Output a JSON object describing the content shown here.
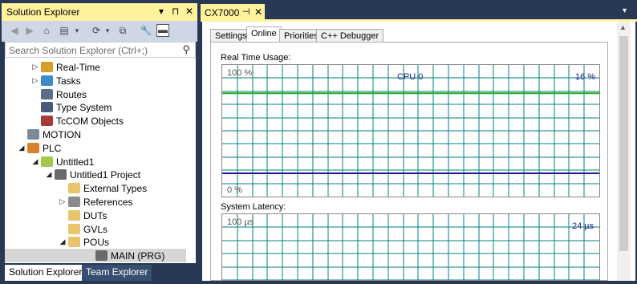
{
  "solution_explorer": {
    "title": "Solution Explorer",
    "title_controls": {
      "dropdown": "▾",
      "pin": "⊓",
      "close": "✕"
    },
    "search_placeholder": "Search Solution Explorer (Ctrl+;)",
    "search_icon": "⚲",
    "tree": [
      {
        "label": "Real-Time",
        "indent": 1,
        "arrow": "▷",
        "icon": "realtime-icon",
        "color": "#D89E2A"
      },
      {
        "label": "Tasks",
        "indent": 1,
        "arrow": "▷",
        "icon": "tasks-icon",
        "color": "#3E8BC9"
      },
      {
        "label": "Routes",
        "indent": 1,
        "arrow": "",
        "icon": "routes-icon",
        "color": "#5A6E8C"
      },
      {
        "label": "Type System",
        "indent": 1,
        "arrow": "",
        "icon": "type-system-icon",
        "color": "#4A5A7A"
      },
      {
        "label": "TcCOM Objects",
        "indent": 1,
        "arrow": "",
        "icon": "tccom-icon",
        "color": "#A93A3A"
      },
      {
        "label": "MOTION",
        "indent": 0,
        "arrow": "",
        "icon": "motion-icon",
        "color": "#7A8A9A"
      },
      {
        "label": "PLC",
        "indent": 0,
        "arrow": "◢",
        "icon": "plc-icon",
        "color": "#D9822B"
      },
      {
        "label": "Untitled1",
        "indent": 1,
        "arrow": "◢",
        "icon": "plc-project-icon",
        "color": "#A3C84B"
      },
      {
        "label": "Untitled1 Project",
        "indent": 2,
        "arrow": "◢",
        "icon": "project-icon",
        "color": "#6A6A6A"
      },
      {
        "label": "External Types",
        "indent": 3,
        "arrow": "",
        "icon": "folder-icon",
        "color": "#E8C46A"
      },
      {
        "label": "References",
        "indent": 3,
        "arrow": "▷",
        "icon": "references-icon",
        "color": "#8A8A8A"
      },
      {
        "label": "DUTs",
        "indent": 3,
        "arrow": "",
        "icon": "folder-icon",
        "color": "#E8C46A"
      },
      {
        "label": "GVLs",
        "indent": 3,
        "arrow": "",
        "icon": "folder-icon",
        "color": "#E8C46A"
      },
      {
        "label": "POUs",
        "indent": 3,
        "arrow": "◢",
        "icon": "folder-open-icon",
        "color": "#E8C46A"
      },
      {
        "label": "MAIN (PRG)",
        "indent": 5,
        "arrow": "",
        "icon": "program-icon",
        "color": "#6A6A6A",
        "selected": true
      }
    ],
    "bottom_tabs": [
      {
        "label": "Solution Explorer",
        "active": true
      },
      {
        "label": "Team Explorer",
        "active": false
      }
    ]
  },
  "document": {
    "tab_title": "CX7000",
    "tab_pin": "⊣",
    "tab_close": "✕",
    "dropdown": "▾",
    "property_tabs": [
      "Settings",
      "Online",
      "Priorities",
      "C++ Debugger"
    ],
    "active_property_tab": "Online",
    "real_time_usage": {
      "label": "Real Time Usage:",
      "top_label": "100 %",
      "bottom_label": "0 %",
      "series_label": "CPU 0",
      "value_label": "16 %"
    },
    "system_latency": {
      "label": "System Latency:",
      "top_label": "100 µs",
      "value_label": "24 µs"
    }
  },
  "colors": {
    "title_bg": "#FFF29D",
    "frame_bg": "#293955",
    "grid": "#008080",
    "cpu_line": "#1E1E8A",
    "limit_line": "#22AA22",
    "toolbar_bg": "#CFD6E5"
  },
  "chart_data": [
    {
      "type": "line",
      "title": "Real Time Usage:",
      "ylim": [
        0,
        100
      ],
      "series": [
        {
          "name": "CPU 0",
          "values": [
            16,
            16,
            16,
            16,
            16,
            16,
            16,
            16,
            16,
            16,
            16,
            16,
            16,
            16,
            16,
            16,
            16,
            16,
            16,
            16,
            16,
            16,
            16,
            16,
            16
          ]
        }
      ],
      "current_value_label": "16 %",
      "limit_value": 80,
      "grid": true
    },
    {
      "type": "line",
      "title": "System Latency:",
      "ylim": [
        0,
        100
      ],
      "current_value_label": "24 µs",
      "grid": true
    }
  ]
}
